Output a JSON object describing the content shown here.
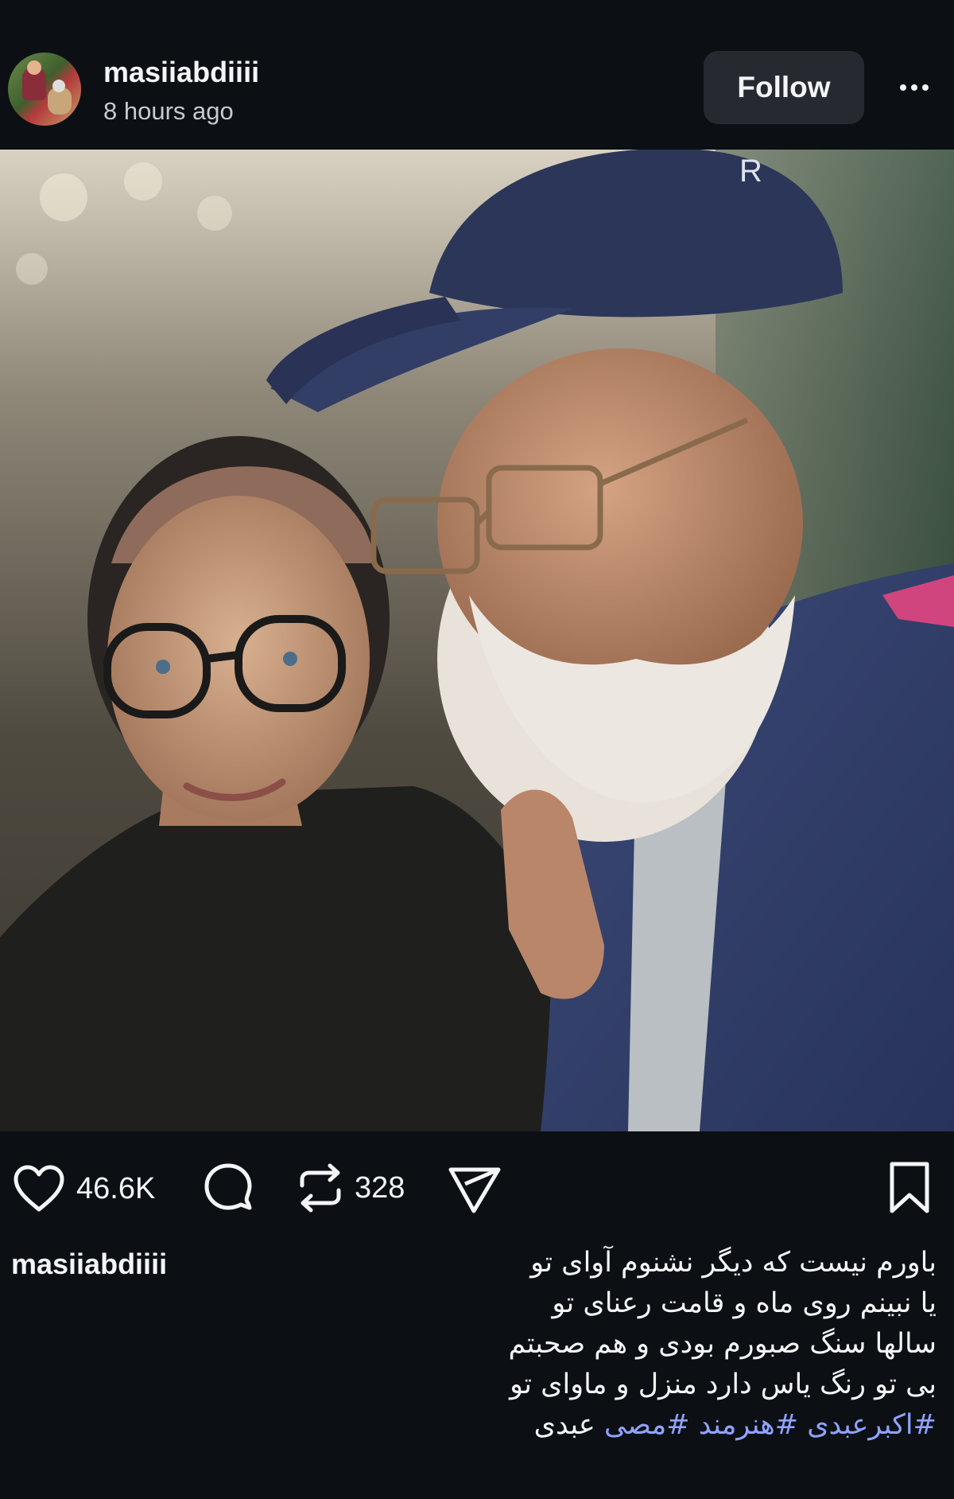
{
  "post": {
    "username": "masiiabdiiii",
    "time_ago": "8 hours ago",
    "follow_label": "Follow",
    "likes": "46.6K",
    "reposts": "328",
    "caption_username": "masiiabdiiii",
    "caption_lines": [
      "باورم نیست که دیگر نشنوم آوای تو",
      "یا نبینم روی ماه و قامت رعنای تو",
      "سالها سنگ صبورم بودی و هم صحبتم",
      "بی تو رنگ یاس دارد منزل و ماوای تو"
    ],
    "hashtags": [
      "#اکبرعبدی",
      "#هنرمند",
      "#مصی"
    ],
    "caption_tail": "عبدی"
  },
  "icons": {
    "like": "heart-icon",
    "comment": "comment-bubble-icon",
    "repost": "repost-icon",
    "share": "send-icon",
    "save": "bookmark-icon",
    "more": "more-dots-icon"
  },
  "colors": {
    "background": "#0c0f14",
    "button": "#262a30",
    "text": "#f3f5f7",
    "secondary_text": "#c7cbd1",
    "hashtag": "#8fa3ff"
  }
}
